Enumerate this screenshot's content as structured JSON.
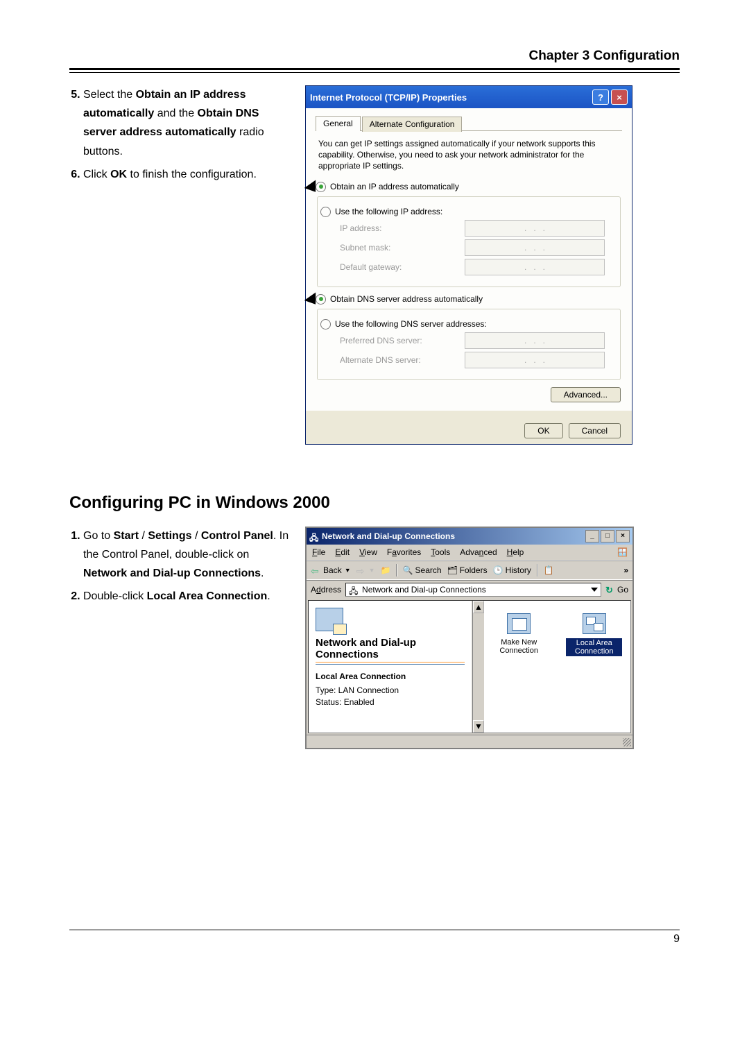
{
  "header": {
    "title": "Chapter 3 Configuration"
  },
  "section1": {
    "steps": [
      {
        "num": "5.",
        "parts": [
          "Select the ",
          "Obtain an IP address automatically",
          " and the ",
          "Obtain DNS server address automatically",
          " radio buttons."
        ]
      },
      {
        "num": "6.",
        "parts": [
          "Click ",
          "OK",
          " to finish the configuration."
        ]
      }
    ]
  },
  "xp_dialog": {
    "title": "Internet Protocol (TCP/IP) Properties",
    "tabs": [
      "General",
      "Alternate Configuration"
    ],
    "desc": "You can get IP settings assigned automatically if your network supports this capability. Otherwise, you need to ask your network administrator for the appropriate IP settings.",
    "radio_auto_ip": "Obtain an IP address automatically",
    "radio_manual_ip": "Use the following IP address:",
    "fields_ip": [
      "IP address:",
      "Subnet mask:",
      "Default gateway:"
    ],
    "radio_auto_dns": "Obtain DNS server address automatically",
    "radio_manual_dns": "Use the following DNS server addresses:",
    "fields_dns": [
      "Preferred DNS server:",
      "Alternate DNS server:"
    ],
    "advanced": "Advanced...",
    "ok": "OK",
    "cancel": "Cancel"
  },
  "section2_heading": "Configuring PC in Windows 2000",
  "section2": {
    "steps": [
      {
        "num": "1.",
        "parts": [
          "Go to ",
          "Start",
          " / ",
          "Settings",
          " / ",
          "Control Panel",
          ". In the Control Panel, double-click on ",
          "Network and Dial-up Connections",
          "."
        ]
      },
      {
        "num": "2.",
        "parts": [
          "Double-click ",
          "Local Area Connection",
          "."
        ]
      }
    ]
  },
  "w2k": {
    "title": "Network and Dial-up Connections",
    "menus": [
      "File",
      "Edit",
      "View",
      "Favorites",
      "Tools",
      "Advanced",
      "Help"
    ],
    "tb_back": "Back",
    "tb_search": "Search",
    "tb_folders": "Folders",
    "tb_history": "History",
    "addr_label": "Address",
    "addr_value": "Network and Dial-up Connections",
    "go": "Go",
    "left_title": "Network and Dial-up Connections",
    "left_sub": "Local Area Connection",
    "left_type": "Type: LAN Connection",
    "left_status": "Status: Enabled",
    "item_make": "Make New Connection",
    "item_local": "Local Area Connection"
  },
  "page_number": "9"
}
